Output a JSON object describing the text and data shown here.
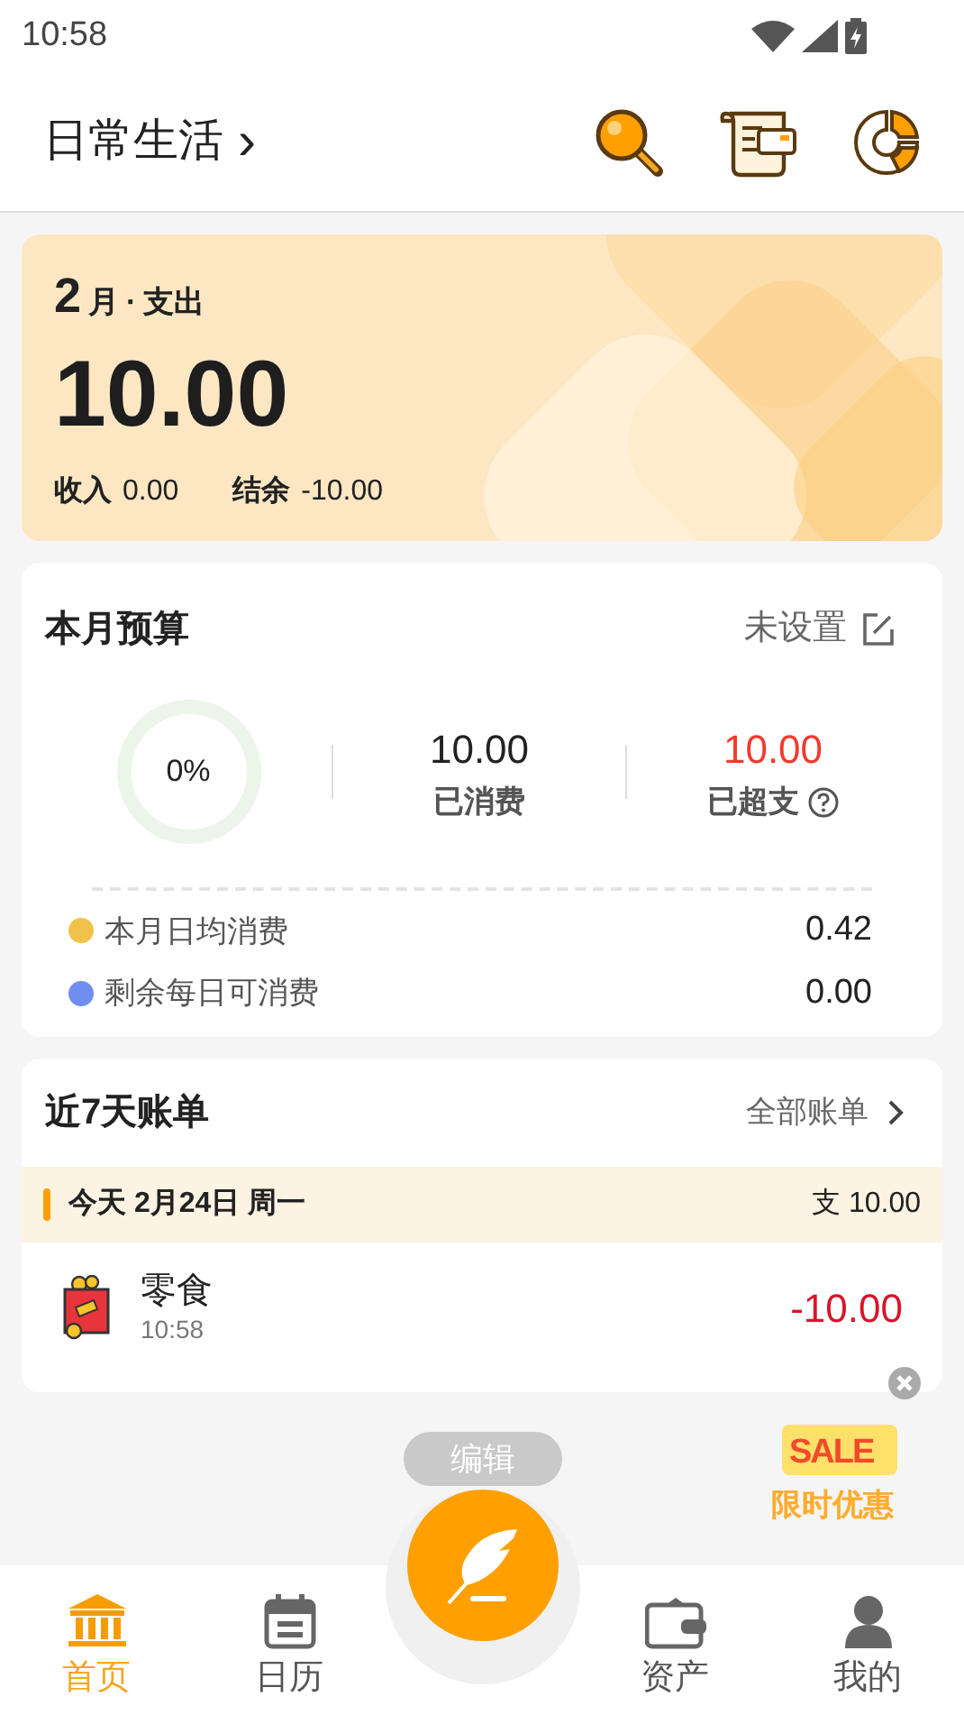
{
  "status_bar": {
    "time": "10:58"
  },
  "header": {
    "title": "日常生活",
    "chevron": "›"
  },
  "summary": {
    "month": "2",
    "month_unit": "月",
    "separator": "·",
    "type": "支出",
    "amount": "10.00",
    "income_label": "收入",
    "income": "0.00",
    "balance_label": "结余",
    "balance": "-10.00"
  },
  "budget": {
    "title": "本月预算",
    "status": "未设置",
    "ring": {
      "label": "0%",
      "level": 0
    },
    "stats": [
      {
        "value": "10.00",
        "label": "已消费",
        "over": false,
        "help": false
      },
      {
        "value": "10.00",
        "label": "已超支",
        "over": true,
        "help": true
      }
    ],
    "rows": [
      {
        "label": "本月日均消费",
        "value": "0.42",
        "color": "#f0c24a"
      },
      {
        "label": "剩余每日可消费",
        "value": "0.00",
        "color": "#6f8ff0"
      }
    ]
  },
  "recent": {
    "title": "近7天账单",
    "link": "全部账单",
    "days": [
      {
        "date": "今天 2月24日 周一",
        "total": "支 10.00",
        "entries": [
          {
            "category": "零食",
            "time": "10:58",
            "amount": "-10.00"
          }
        ]
      }
    ]
  },
  "edit_button": "编辑",
  "promo": {
    "sale": "SALE",
    "caption": "限时优惠"
  },
  "tabs": [
    {
      "label": "首页",
      "selected": true
    },
    {
      "label": "日历",
      "selected": false
    },
    {
      "label": "资产",
      "selected": false
    },
    {
      "label": "我的",
      "selected": false
    }
  ]
}
